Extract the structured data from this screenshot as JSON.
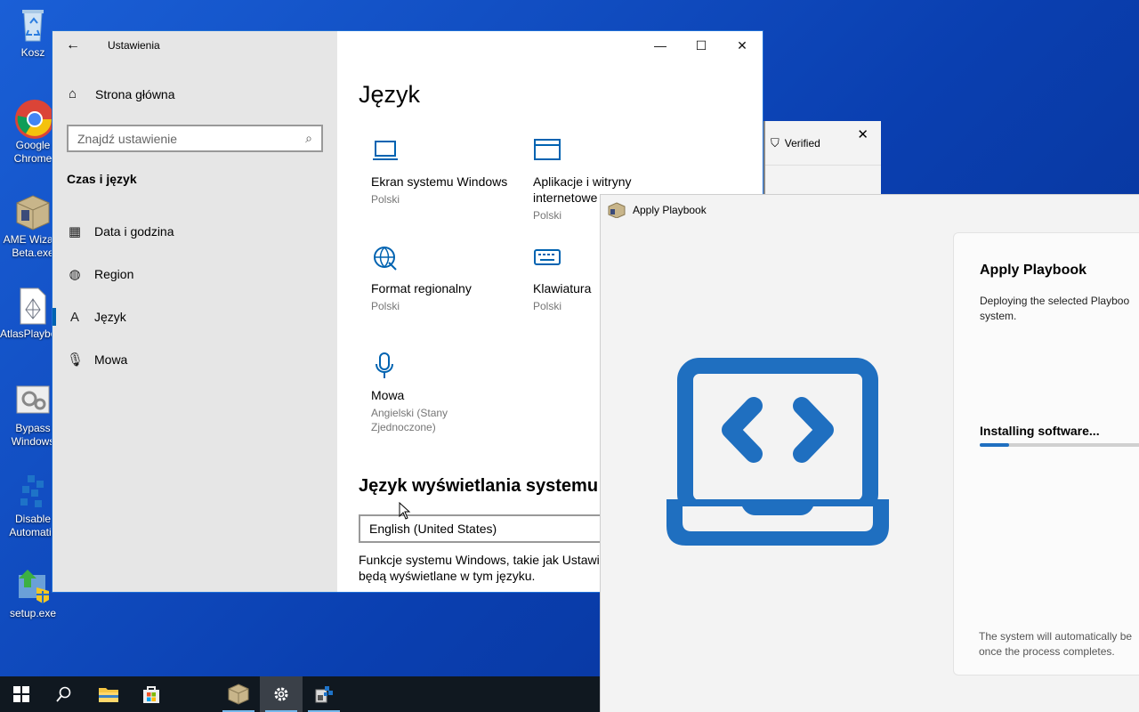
{
  "desktop": {
    "icons": [
      {
        "label": "Kosz",
        "icon": "recycle-bin-icon"
      },
      {
        "label": "Google Chrome",
        "icon": "chrome-icon"
      },
      {
        "label": "AME Wizard Beta.exe",
        "icon": "ame-wizard-icon"
      },
      {
        "label": "AtlasPlaybook",
        "icon": "playbook-file-icon"
      },
      {
        "label": "Bypass Windows",
        "icon": "settings-file-icon"
      },
      {
        "label": "Disable Automatic",
        "icon": "registry-icon"
      },
      {
        "label": "setup.exe",
        "icon": "setup-icon"
      }
    ]
  },
  "settings": {
    "title": "Ustawienia",
    "home": "Strona główna",
    "search_placeholder": "Znajdź ustawienie",
    "section": "Czas i język",
    "nav": [
      {
        "label": "Data i godzina",
        "icon": "calendar-icon"
      },
      {
        "label": "Region",
        "icon": "globe-icon"
      },
      {
        "label": "Język",
        "icon": "language-icon"
      },
      {
        "label": "Mowa",
        "icon": "microphone-icon"
      }
    ],
    "page_title": "Język",
    "tiles": [
      {
        "name": "Ekran systemu Windows",
        "sub": "Polski",
        "icon": "laptop-icon"
      },
      {
        "name": "Aplikacje i witryny internetowe",
        "sub": "Polski",
        "icon": "window-icon"
      },
      {
        "name": "Format regionalny",
        "sub": "Polski",
        "icon": "globe-icon"
      },
      {
        "name": "Klawiatura",
        "sub": "Polski",
        "icon": "keyboard-icon"
      },
      {
        "name": "Mowa",
        "sub": "Angielski (Stany Zjednoczone)",
        "icon": "microphone-icon"
      }
    ],
    "display_language_heading": "Język wyświetlania systemu Wi",
    "display_language_value": "English (United States)",
    "description_line1": "Funkcje systemu Windows, takie jak Ustawie",
    "description_line2": "będą wyświetlane w tym języku."
  },
  "verified": {
    "label": "Verified"
  },
  "playbook": {
    "window_title": "Apply Playbook",
    "heading": "Apply Playbook",
    "description_line1": "Deploying the selected Playboo",
    "description_line2": "system.",
    "status": "Installing software...",
    "progress": 0.15,
    "footer_line1": "The system will automatically be",
    "footer_line2": "once the process completes."
  },
  "taskbar": {
    "items": [
      "start-icon",
      "search-icon",
      "file-explorer-icon",
      "store-icon",
      "ame-wizard-icon",
      "settings-icon",
      "registry-editor-icon"
    ]
  },
  "colors": {
    "accent": "#0063b1",
    "playbook_blue": "#1f6fc0"
  }
}
